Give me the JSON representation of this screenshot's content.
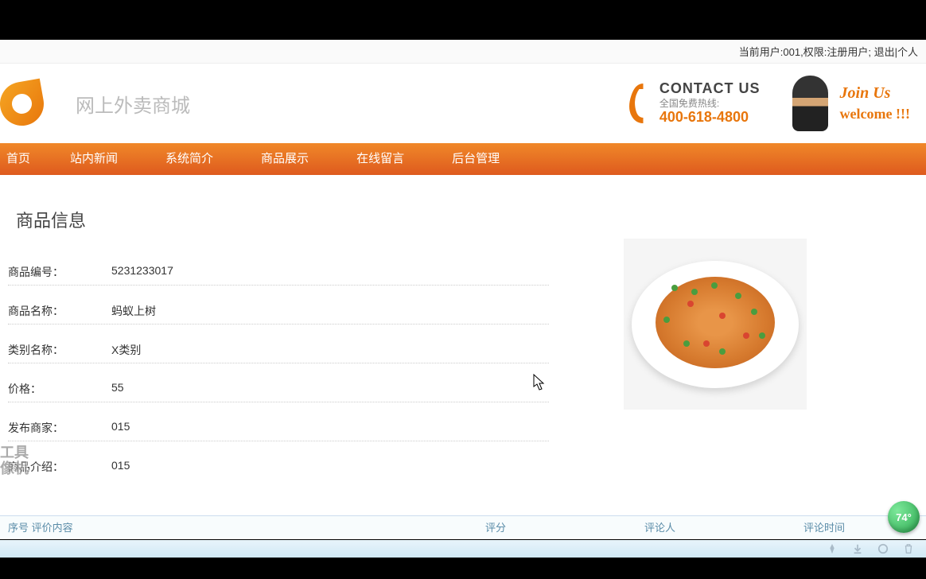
{
  "topbar": {
    "current_user_label": "当前用户:",
    "current_user": "001",
    "role_label": ",权限:",
    "role": "注册用户",
    "logout": "; 退出",
    "personal": "|个人"
  },
  "header": {
    "site_title": "网上外卖商城",
    "contact_us": "CONTACT US",
    "contact_sub": "全国免费热线:",
    "contact_phone": "400-618-4800",
    "join_us": "Join Us",
    "welcome": "welcome !!!"
  },
  "nav": {
    "items": [
      "首页",
      "站内新闻",
      "系统简介",
      "商品展示",
      "在线留言",
      "后台管理"
    ]
  },
  "section_title": "商品信息",
  "details": {
    "id_label": "商品编号：",
    "id_value": "5231233017",
    "name_label": "商品名称：",
    "name_value": "蚂蚁上树",
    "category_label": "类别名称：",
    "category_value": "X类别",
    "price_label": "价格：",
    "price_value": "55",
    "seller_label": "发布商家：",
    "seller_value": "015",
    "desc_label": "商品介绍：",
    "desc_value": "015"
  },
  "watermark": {
    "line1": "工具",
    "line2": "像机"
  },
  "bottom": {
    "col1": "序号  评价内容",
    "col2": "评分",
    "col3": "评论人",
    "col4": "评论时间"
  },
  "badge": "74°"
}
